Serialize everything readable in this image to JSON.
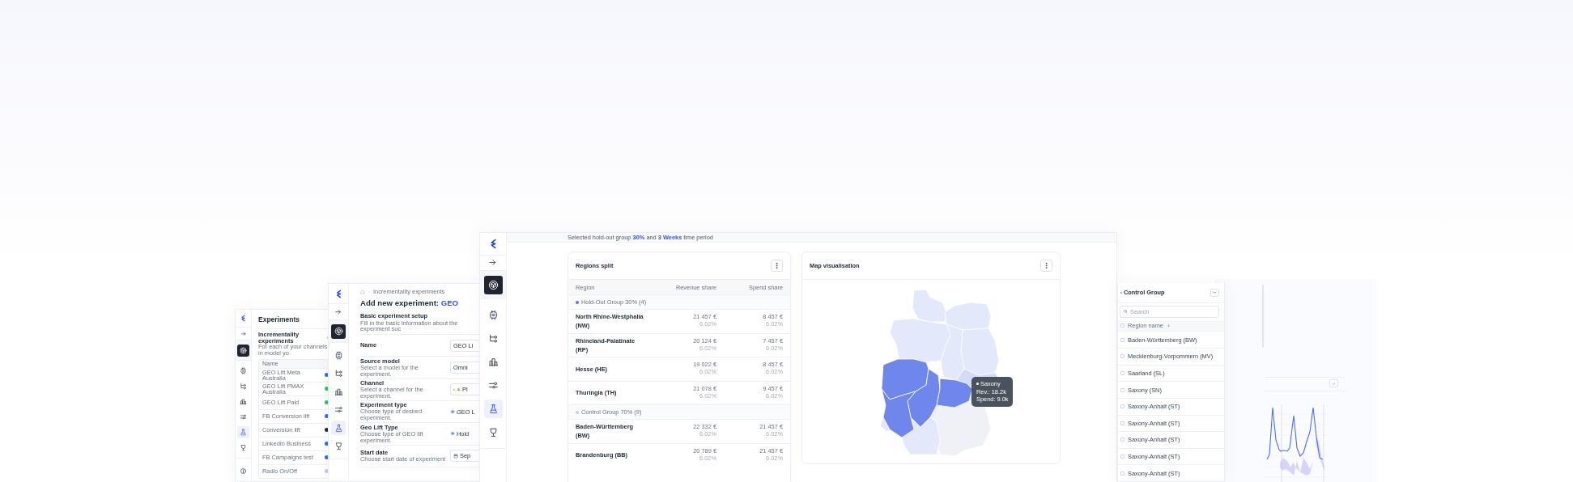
{
  "experiments_window": {
    "sidebar": [
      {
        "selected": true,
        "highlighted": false
      },
      {
        "selected": false,
        "highlighted": false
      },
      {
        "selected": false,
        "highlighted": false
      },
      {
        "selected": false,
        "highlighted": false
      },
      {
        "selected": false,
        "highlighted": false
      },
      {
        "selected": false,
        "highlighted": true
      },
      {
        "selected": false,
        "highlighted": false
      }
    ],
    "title": "Experiments",
    "section_title": "Incrementality experiments",
    "section_subtitle": "For each of your channels in model yo",
    "column": "Name",
    "rows": [
      {
        "name": "GEO Lift Meta Australia",
        "color": "#2f6bff"
      },
      {
        "name": "GEO Lift PMAX Australia",
        "color": "#22c55e"
      },
      {
        "name": "GEO Lift Paid",
        "color": "#22c55e"
      },
      {
        "name": "FB Conversion lift",
        "color": "#2f6bff"
      },
      {
        "name": "Conversion lift",
        "color": "#1f2937"
      },
      {
        "name": "LinkedIn Business",
        "color": "#2f6bff"
      },
      {
        "name": "FB Campaigns test",
        "color": "#2f6bff"
      },
      {
        "name": "Radio On/Off",
        "color": "#c9c2fb"
      }
    ]
  },
  "setup_window": {
    "sidebar": [
      {
        "selected": true,
        "highlighted": false
      },
      {
        "selected": false,
        "highlighted": false
      },
      {
        "selected": false,
        "highlighted": false
      },
      {
        "selected": false,
        "highlighted": false
      },
      {
        "selected": false,
        "highlighted": false
      },
      {
        "selected": false,
        "highlighted": true
      },
      {
        "selected": false,
        "highlighted": false
      }
    ],
    "breadcrumb": "Incrementality experiments",
    "heading": "Add new experiment: **GEO**",
    "section_title": "Basic experiment setup",
    "section_subtitle": "Fill in the basic information about the experiment suc",
    "fields": [
      {
        "kind": "input",
        "label": "Name",
        "value": "GEO Li"
      },
      {
        "kind": "input",
        "label": "Source model",
        "hint": "Select a model for the experiment.",
        "value": "Omni"
      },
      {
        "kind": "channel",
        "label": "Channel",
        "hint": "Select a channel for the experiment.",
        "value": "Pl"
      },
      {
        "kind": "radio",
        "label": "Experiment type",
        "hint": "Choose type of desired experiment.",
        "value": "GEO L"
      },
      {
        "kind": "radio",
        "label": "Geo Lift Type",
        "hint": "Choose type of GEO lift experiment.",
        "value": "Hold"
      },
      {
        "kind": "date",
        "label": "Start date",
        "hint": "Choose start date of experiment",
        "value": "Sep"
      }
    ]
  },
  "main_window": {
    "sidebar": [
      {
        "selected": true,
        "highlighted": false
      },
      {
        "selected": false,
        "highlighted": false
      },
      {
        "selected": false,
        "highlighted": false
      },
      {
        "selected": false,
        "highlighted": false
      },
      {
        "selected": false,
        "highlighted": false
      },
      {
        "selected": false,
        "highlighted": true
      },
      {
        "selected": false,
        "highlighted": false
      }
    ],
    "banner": "Selected hold-out group **30%** and **3 Weeks** time period",
    "regions_card": {
      "title": "Regions split",
      "columns": [
        "Region",
        "Revenue share",
        "Spend share"
      ],
      "groups": [
        {
          "label": "Hold-Out Group 30% (4)",
          "color": "#5b6ff0",
          "rows": [
            {
              "region": "North Rhine-Westphalia (NW)",
              "revenue": "21 457 €",
              "revenue_share": "6.02%",
              "spend": "8 457 €",
              "spend_share": "6.02%"
            },
            {
              "region": "Rhineland-Palatinate (RP)",
              "revenue": "20 124 €",
              "revenue_share": "6.02%",
              "spend": "7 457 €",
              "spend_share": "6.02%"
            },
            {
              "region": "Hesse (HE)",
              "revenue": "19 022 €",
              "revenue_share": "6.02%",
              "spend": "8 457 €",
              "spend_share": "6.02%"
            },
            {
              "region": "Thuringia (TH)",
              "revenue": "21 078 €",
              "revenue_share": "6.02%",
              "spend": "9 457 €",
              "spend_share": "6.02%"
            }
          ]
        },
        {
          "label": "Control Group 70% (9)",
          "color": "#c5ccf8",
          "rows": [
            {
              "region": "Baden-Württemberg (BW)",
              "revenue": "22 332 €",
              "revenue_share": "6.02%",
              "spend": "21 457 €",
              "spend_share": "6.02%"
            },
            {
              "region": "Brandenburg (BB)",
              "revenue": "20 789 €",
              "revenue_share": "6.02%",
              "spend": "21 457 €",
              "spend_share": "6.02%"
            }
          ]
        }
      ]
    },
    "map_card": {
      "title": "Map visualisation",
      "tooltip": {
        "title": "Saxony",
        "lines": [
          "Rev.: 18.2k",
          "Spend: 9.0k"
        ]
      }
    }
  },
  "control_panel": {
    "title": "Control Group",
    "search": {
      "placeholder": "Search"
    },
    "column": "Region name",
    "select_all": {
      "checked": false
    },
    "rows": [
      {
        "label": "Baden-Württemberg (BW)",
        "checked": false
      },
      {
        "label": "Mecklenburg-Vorpommern (MV)",
        "checked": false
      },
      {
        "label": "Saarland (SL)",
        "checked": false
      },
      {
        "label": "Saxony (SN)",
        "checked": false
      },
      {
        "label": "Saxony-Anhalt (ST)",
        "checked": false
      },
      {
        "label": "Saxony-Anhalt (ST)",
        "checked": false
      },
      {
        "label": "Saxony-Anhalt (ST)",
        "checked": false
      },
      {
        "label": "Saxony-Anhalt (ST)",
        "checked": false
      },
      {
        "label": "Saxony-Anhalt (ST)",
        "checked": false
      }
    ]
  }
}
